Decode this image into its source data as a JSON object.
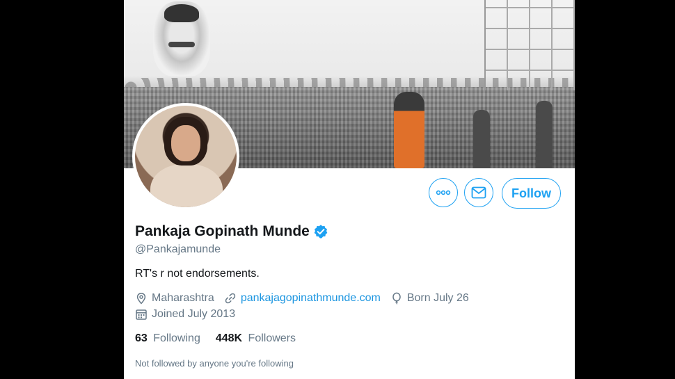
{
  "profile": {
    "display_name": "Pankaja Gopinath Munde",
    "handle": "@Pankajamunde",
    "bio": "RT's r not endorsements.",
    "location": "Maharashtra",
    "website": "pankajagopinathmunde.com",
    "birthday": "Born July 26",
    "joined": "Joined July 2013",
    "verified": true
  },
  "actions": {
    "more_icon": "more-options-icon",
    "message_icon": "envelope-icon",
    "follow_label": "Follow"
  },
  "stats": {
    "following_count": "63",
    "following_label": "Following",
    "followers_count": "448K",
    "followers_label": "Followers"
  },
  "social_context": "Not followed by anyone you're following",
  "colors": {
    "accent": "#1da1f2",
    "link": "#1b95e0",
    "secondary_text": "#657786",
    "primary_text": "#14171a"
  }
}
